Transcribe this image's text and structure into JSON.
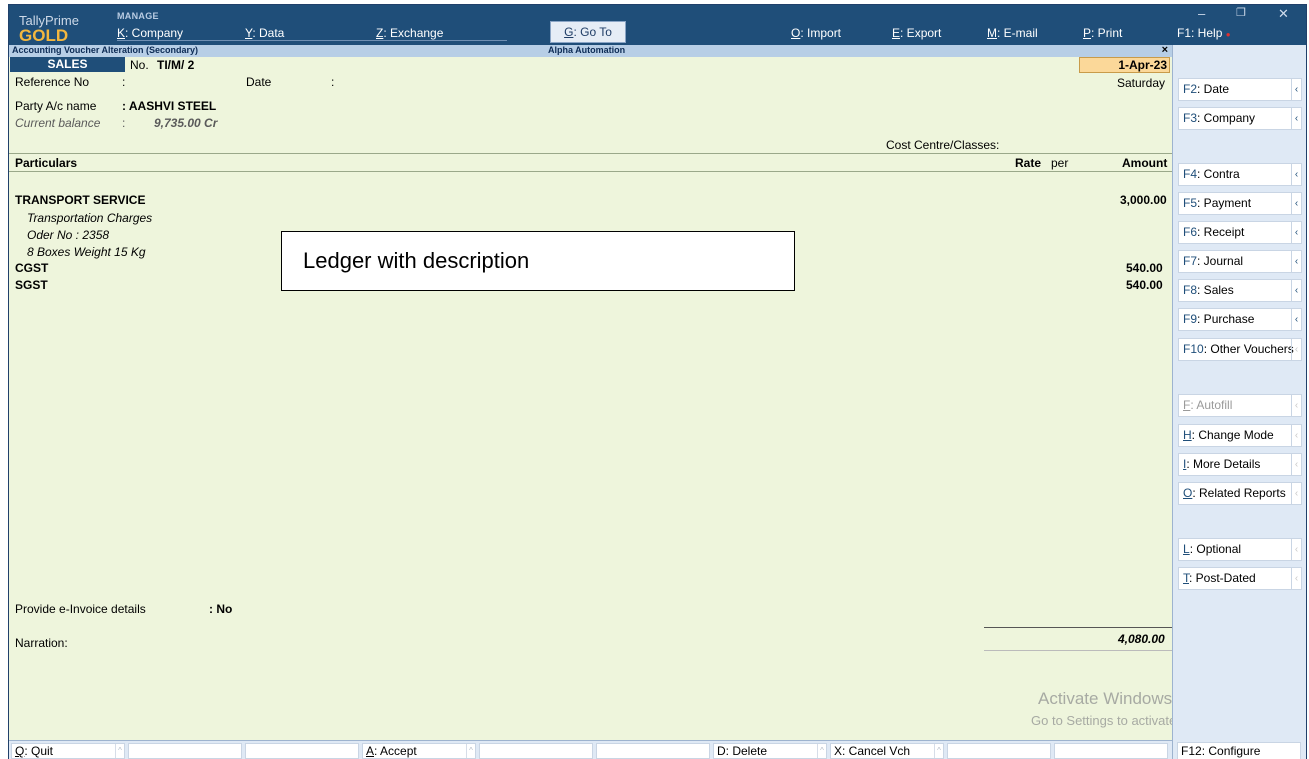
{
  "brand": {
    "product": "TallyPrime",
    "edition": "GOLD",
    "section": "MANAGE"
  },
  "menu": [
    {
      "key": "K",
      "label": ": Company"
    },
    {
      "key": "Y",
      "label": ": Data"
    },
    {
      "key": "Z",
      "label": ": Exchange"
    },
    {
      "key": "G",
      "label": ": Go To"
    },
    {
      "key": "O",
      "label": ": Import"
    },
    {
      "key": "E",
      "label": ": Export"
    },
    {
      "key": "M",
      "label": ": E-mail"
    },
    {
      "key": "P",
      "label": ": Print"
    },
    {
      "key": "F1",
      "label": ": Help"
    }
  ],
  "window_controls": {
    "minimize": "–",
    "restore": "❐",
    "close": "✕"
  },
  "header": {
    "title": "Accounting Voucher Alteration (Secondary)",
    "company": "Alpha Automation",
    "close": "×"
  },
  "voucher": {
    "type": "SALES",
    "no_label": "No.",
    "no_value": "TI/M/ 2",
    "date_value": "1-Apr-23",
    "day": "Saturday",
    "reference_label": "Reference No",
    "reference_colon": ":",
    "date_label": "Date",
    "date_colon": ":",
    "party_label": "Party A/c name",
    "party_value": ": AASHVI STEEL",
    "balance_label": "Current balance",
    "balance_colon": ":",
    "balance_value": "9,735.00 Cr",
    "cost_centre_label": "Cost Centre/Classes:",
    "col_particulars": "Particulars",
    "col_rate": "Rate",
    "col_per": "per",
    "col_amount": "Amount",
    "entries": [
      {
        "ledger": "TRANSPORT SERVICE",
        "amount": "3,000.00",
        "descriptions": [
          "Transportation Charges",
          "Oder No : 2358",
          "8 Boxes Weight 15 Kg"
        ]
      },
      {
        "ledger": "CGST",
        "amount": "540.00"
      },
      {
        "ledger": "SGST",
        "amount": "540.00"
      }
    ],
    "einvoice_label": "Provide e-Invoice details",
    "einvoice_value": ": No",
    "narration_label": "Narration:",
    "total": "4,080.00"
  },
  "callout": "Ledger with description",
  "watermark": {
    "line1": "Activate Windows",
    "line2": "Go to Settings to activate Windows."
  },
  "right_panel": [
    {
      "key": "F2",
      "label": ": Date"
    },
    {
      "key": "F3",
      "label": ": Company"
    },
    {
      "key": "F4",
      "label": ": Contra"
    },
    {
      "key": "F5",
      "label": ": Payment"
    },
    {
      "key": "F6",
      "label": ": Receipt"
    },
    {
      "key": "F7",
      "label": ": Journal"
    },
    {
      "key": "F8",
      "label": ": Sales"
    },
    {
      "key": "F9",
      "label": ": Purchase"
    },
    {
      "key": "F10",
      "label": ": Other Vouchers"
    },
    {
      "key": "F",
      "label": ": Autofill"
    },
    {
      "key": "H",
      "label": ": Change Mode"
    },
    {
      "key": "I",
      "label": ": More Details"
    },
    {
      "key": "O",
      "label": ": Related Reports"
    },
    {
      "key": "L",
      "label": ": Optional"
    },
    {
      "key": "T",
      "label": ": Post-Dated"
    }
  ],
  "bottom_bar": [
    {
      "key": "Q",
      "label": ": Quit"
    },
    {
      "key": "A",
      "label": ": Accept"
    },
    {
      "key": "D",
      "label": ": Delete"
    },
    {
      "key": "X",
      "label": ": Cancel Vch"
    }
  ],
  "f12": {
    "key": "F12",
    "label": ": Configure"
  },
  "colors": {
    "topbar": "#1f4e79",
    "gold": "#f3b73f",
    "voucher_bg": "#eef5dc",
    "date_highlight": "#fbd899"
  }
}
